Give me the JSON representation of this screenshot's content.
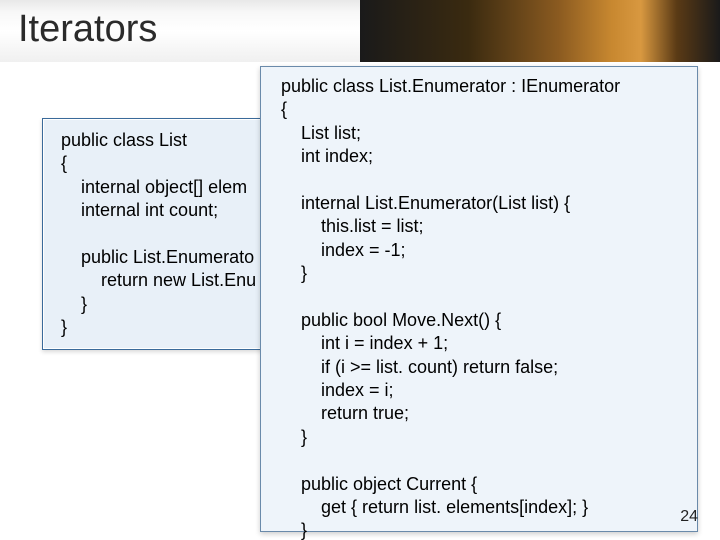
{
  "slide": {
    "title": "Iterators",
    "page_number": "24"
  },
  "code_left": "public class List\n{\n    internal object[] elem\n    internal int count;\n\n    public List.Enumerato\n        return new List.Enu\n    }\n}",
  "code_right": "public class List.Enumerator : IEnumerator\n{\n    List list;\n    int index;\n\n    internal List.Enumerator(List list) {\n        this.list = list;\n        index = -1;\n    }\n\n    public bool Move.Next() {\n        int i = index + 1;\n        if (i >= list. count) return false;\n        index = i;\n        return true;\n    }\n\n    public object Current {\n        get { return list. elements[index]; }\n    }\n}"
}
